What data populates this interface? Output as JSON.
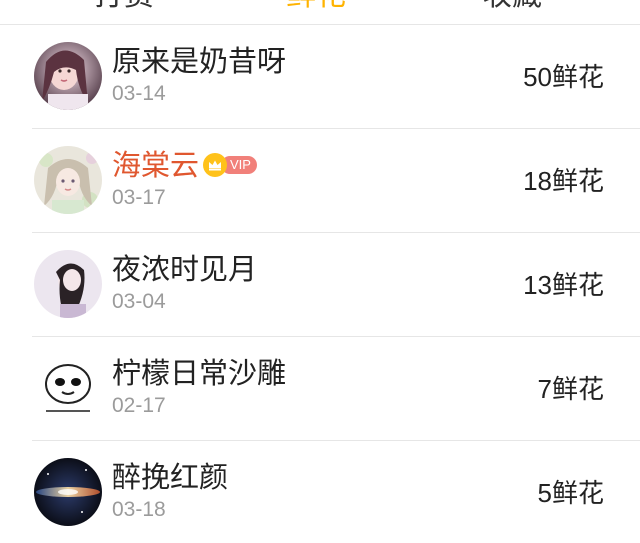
{
  "tabs": [
    {
      "label": "打赏",
      "active": false
    },
    {
      "label": "鲜花",
      "active": true
    },
    {
      "label": "收藏",
      "active": false
    }
  ],
  "colors": {
    "accent": "#ffb300",
    "vip_name": "#e0572f",
    "vip_tag": "#f1807a",
    "crown": "#ffc21a",
    "date": "#9b9b9b",
    "divider": "#e6e6e6"
  },
  "rows": [
    {
      "name": "原来是奶昔呀",
      "date": "03-14",
      "count": "50",
      "unit": "鲜花",
      "vip": false,
      "avatar": "girl-portrait-avatar"
    },
    {
      "name": "海棠云",
      "date": "03-17",
      "count": "18",
      "unit": "鲜花",
      "vip": true,
      "vip_label": "VIP",
      "avatar": "anime-girl-avatar"
    },
    {
      "name": "夜浓时见月",
      "date": "03-04",
      "count": "13",
      "unit": "鲜花",
      "vip": false,
      "avatar": "dark-hair-girl-avatar"
    },
    {
      "name": "柠檬日常沙雕",
      "date": "02-17",
      "count": "7",
      "unit": "鲜花",
      "vip": false,
      "avatar": "meme-face-avatar"
    },
    {
      "name": "醉挽红颜",
      "date": "03-18",
      "count": "5",
      "unit": "鲜花",
      "vip": false,
      "avatar": "galaxy-avatar"
    }
  ]
}
